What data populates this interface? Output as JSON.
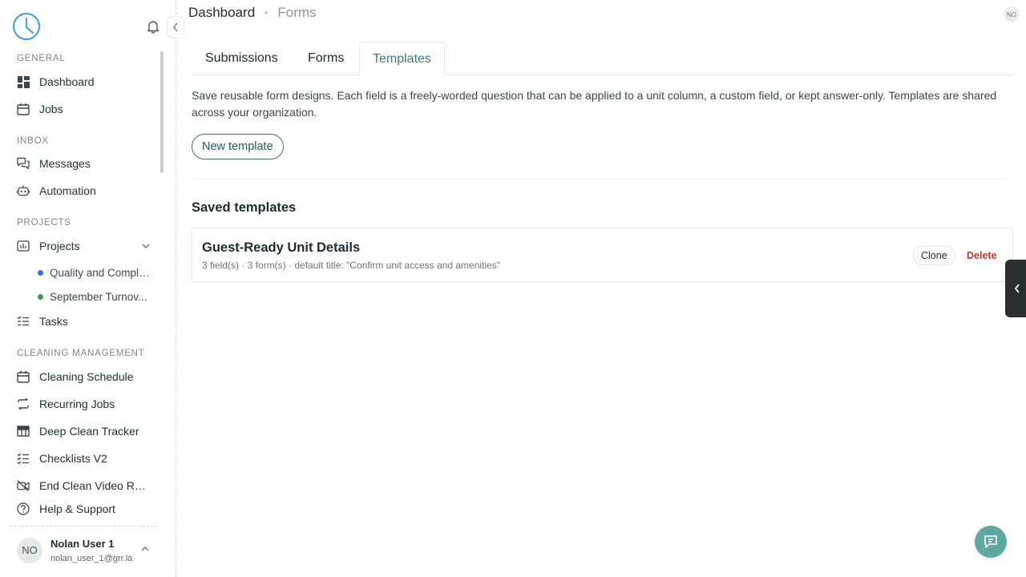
{
  "sidebar": {
    "sections": {
      "general": "GENERAL",
      "inbox": "INBOX",
      "projects": "PROJECTS",
      "cleaning": "CLEANING MANAGEMENT"
    },
    "items": {
      "dashboard": "Dashboard",
      "jobs": "Jobs",
      "messages": "Messages",
      "automation": "Automation",
      "projects": "Projects",
      "tasks": "Tasks",
      "cleaning_schedule": "Cleaning Schedule",
      "recurring_jobs": "Recurring Jobs",
      "deep_clean_tracker": "Deep Clean Tracker",
      "checklists_v2": "Checklists V2",
      "end_clean_video": "End Clean Video Rep...",
      "help_support": "Help & Support"
    },
    "project_children": [
      {
        "label": "Quality and Compli...",
        "color": "#3b73c7"
      },
      {
        "label": "September Turnov...",
        "color": "#3f9a62"
      }
    ],
    "user": {
      "initials": "NO",
      "name": "Nolan User 1",
      "email": "nolan_user_1@grr.la"
    }
  },
  "header": {
    "breadcrumb": [
      "Dashboard",
      "Forms"
    ],
    "avatar_initials": "NO"
  },
  "tabs": [
    "Submissions",
    "Forms",
    "Templates"
  ],
  "active_tab": "Templates",
  "main": {
    "description": "Save reusable form designs. Each field is a freely-worded question that can be applied to a unit column, a custom field, or kept answer-only. Templates are shared across your organization.",
    "new_template_label": "New template",
    "saved_title": "Saved templates",
    "templates": [
      {
        "title": "Guest-Ready Unit Details",
        "meta": "3 field(s) · 3 form(s) · default title: \"Confirm unit access and amenities\"",
        "clone_label": "Clone",
        "delete_label": "Delete"
      }
    ]
  },
  "colors": {
    "accent": "#3f7a84",
    "danger": "#c0392b",
    "fab": "#5da8a3"
  }
}
